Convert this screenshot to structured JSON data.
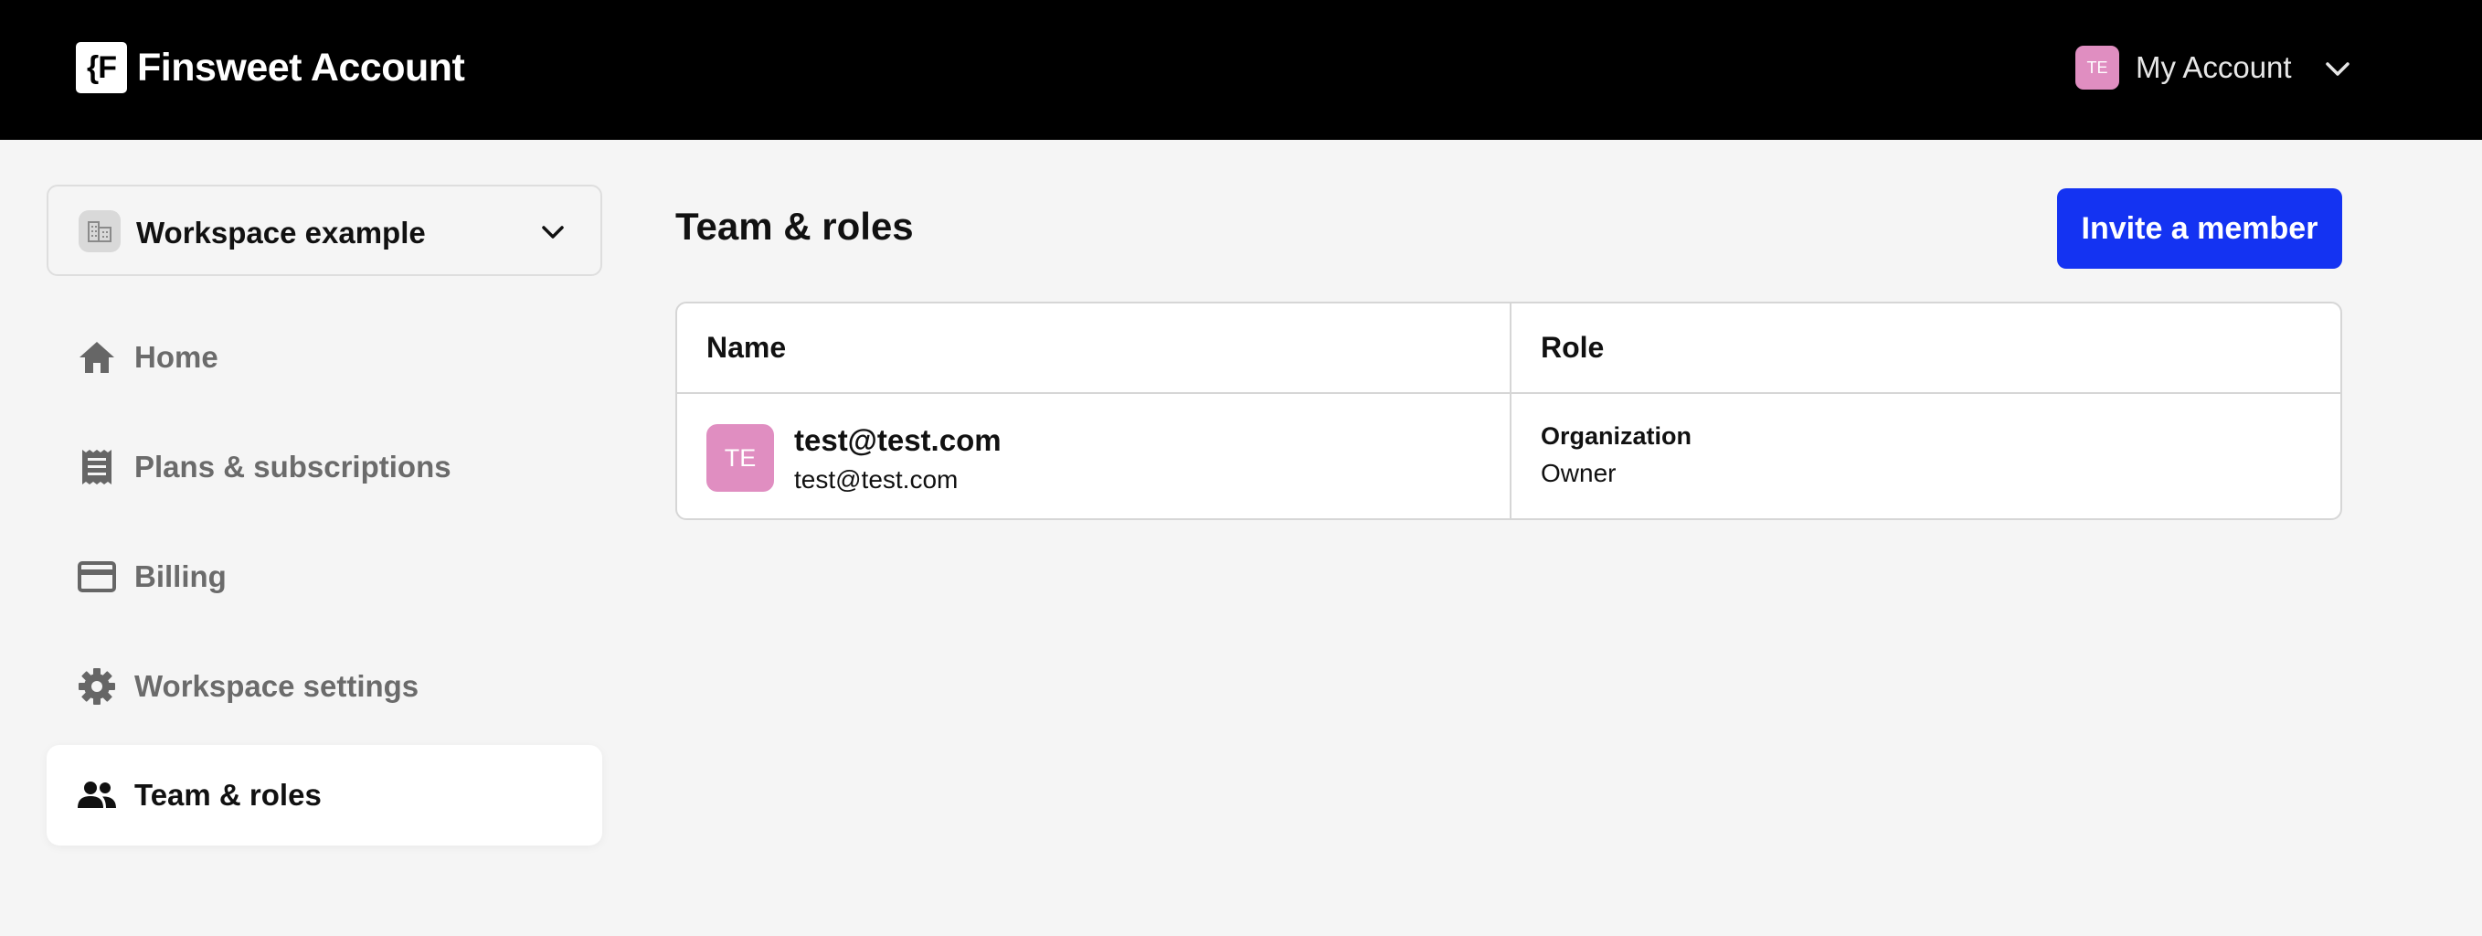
{
  "header": {
    "logo_text": "{F",
    "brand_name": "Finsweet Account",
    "account_initials": "TE",
    "account_label": "My Account"
  },
  "sidebar": {
    "workspace": {
      "name": "Workspace example"
    },
    "items": [
      {
        "label": "Home",
        "icon": "home-icon"
      },
      {
        "label": "Plans & subscriptions",
        "icon": "receipt-icon"
      },
      {
        "label": "Billing",
        "icon": "credit-card-icon"
      },
      {
        "label": "Workspace settings",
        "icon": "gear-icon"
      },
      {
        "label": "Team & roles",
        "icon": "people-icon",
        "active": true
      }
    ]
  },
  "main": {
    "title": "Team & roles",
    "invite_label": "Invite a member",
    "table": {
      "columns": [
        "Name",
        "Role"
      ],
      "rows": [
        {
          "initials": "TE",
          "name": "test@test.com",
          "email": "test@test.com",
          "role_scope": "Organization",
          "role": "Owner"
        }
      ]
    }
  },
  "colors": {
    "topbar": "#000000",
    "background": "#f5f5f5",
    "accent": "#1433f2",
    "avatar": "#e08ec1",
    "muted_text": "#6b6b6b"
  }
}
